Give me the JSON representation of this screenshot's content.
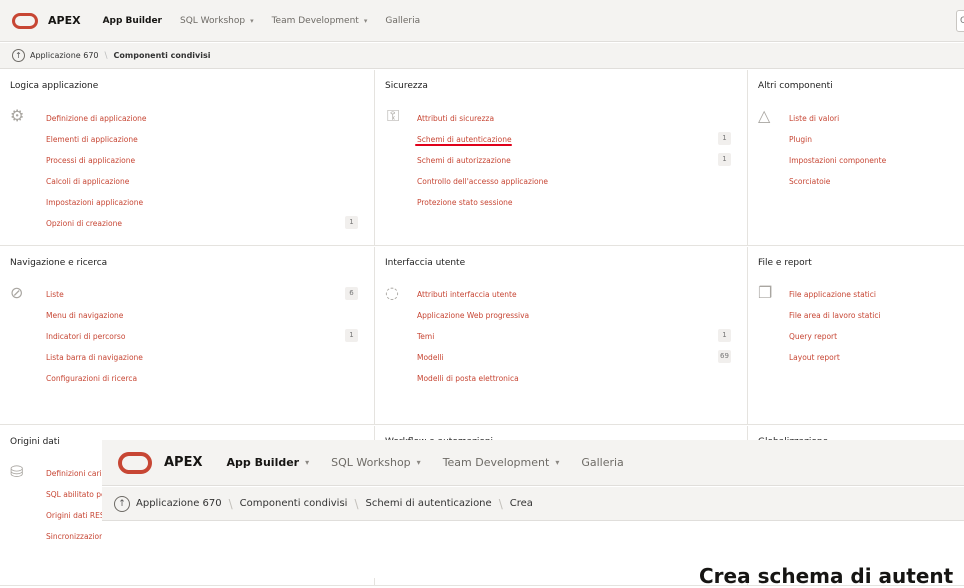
{
  "header": {
    "brand": "APEX",
    "nav": [
      {
        "label": "App Builder",
        "active": true
      },
      {
        "label": "SQL Workshop"
      },
      {
        "label": "Team Development"
      },
      {
        "label": "Galleria"
      }
    ],
    "search_fragment": "Q"
  },
  "breadcrumb": {
    "items": [
      "Applicazione 670",
      "Componenti condivisi"
    ]
  },
  "panels": {
    "logica": {
      "title": "Logica applicazione",
      "icon": "gear-icon",
      "links": [
        {
          "label": "Definizione di applicazione"
        },
        {
          "label": "Elementi di applicazione"
        },
        {
          "label": "Processi di applicazione"
        },
        {
          "label": "Calcoli di applicazione"
        },
        {
          "label": "Impostazioni applicazione"
        },
        {
          "label": "Opzioni di creazione",
          "count": "1"
        }
      ]
    },
    "sicurezza": {
      "title": "Sicurezza",
      "icon": "key-icon",
      "links": [
        {
          "label": "Attributi di sicurezza"
        },
        {
          "label": "Schemi di autenticazione",
          "count": "1"
        },
        {
          "label": "Schemi di autorizzazione",
          "count": "1"
        },
        {
          "label": "Controllo dell'accesso applicazione"
        },
        {
          "label": "Protezione stato sessione"
        }
      ]
    },
    "altri": {
      "title": "Altri componenti",
      "icon": "shapes-icon",
      "links": [
        {
          "label": "Liste di valori"
        },
        {
          "label": "Plugin"
        },
        {
          "label": "Impostazioni componente"
        },
        {
          "label": "Scorciatoie"
        }
      ]
    },
    "navigazione": {
      "title": "Navigazione e ricerca",
      "icon": "compass-icon",
      "links": [
        {
          "label": "Liste",
          "count": "6"
        },
        {
          "label": "Menu di navigazione"
        },
        {
          "label": "Indicatori di percorso",
          "count": "1"
        },
        {
          "label": "Lista barra di navigazione"
        },
        {
          "label": "Configurazioni di ricerca"
        }
      ]
    },
    "interfaccia": {
      "title": "Interfaccia utente",
      "icon": "palette-icon",
      "links": [
        {
          "label": "Attributi interfaccia utente"
        },
        {
          "label": "Applicazione Web progressiva"
        },
        {
          "label": "Temi",
          "count": "1"
        },
        {
          "label": "Modelli",
          "count": "69"
        },
        {
          "label": "Modelli di posta elettronica"
        }
      ]
    },
    "file": {
      "title": "File e report",
      "icon": "files-icon",
      "links": [
        {
          "label": "File applicazione statici"
        },
        {
          "label": "File area di lavoro statici"
        },
        {
          "label": "Query report"
        },
        {
          "label": "Layout report"
        }
      ]
    },
    "origini": {
      "title": "Origini dati",
      "icon": "database-icon",
      "links": [
        {
          "label": "Definizioni caric"
        },
        {
          "label": "SQL abilitato pe"
        },
        {
          "label": "Origini dati REST"
        },
        {
          "label": "Sincronizzazione"
        }
      ]
    },
    "workflow": {
      "title": "Workflow e automazioni"
    },
    "globalizzazione": {
      "title": "Globalizzazione"
    }
  },
  "overlay": {
    "brand": "APEX",
    "nav": [
      {
        "label": "App Builder",
        "active": true
      },
      {
        "label": "SQL Workshop"
      },
      {
        "label": "Team Development"
      },
      {
        "label": "Galleria"
      }
    ],
    "breadcrumb": [
      "Applicazione 670",
      "Componenti condivisi",
      "Schemi di autenticazione",
      "Crea"
    ],
    "heading": "Crea schema di autent"
  },
  "colors": {
    "accent": "#c74634",
    "highlight_underline": "#e0001a"
  }
}
